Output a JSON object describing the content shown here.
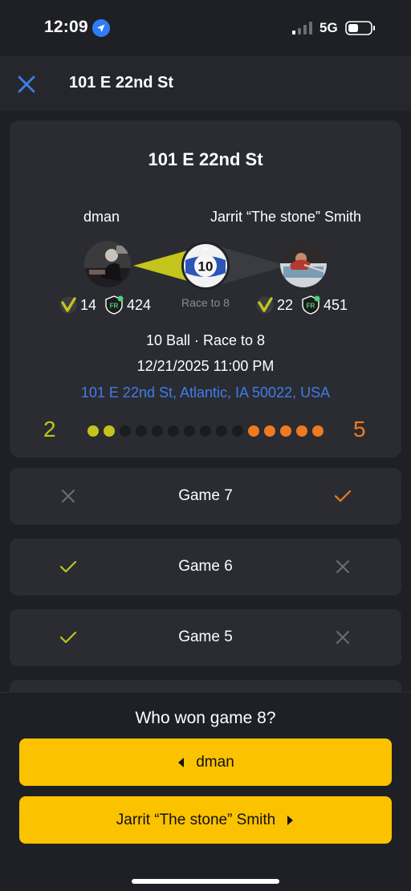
{
  "status_bar": {
    "time": "12:09",
    "network": "5G"
  },
  "header": {
    "title": "101 E 22nd St"
  },
  "match": {
    "title": "101 E 22nd St",
    "player1": {
      "name": "dman",
      "verified_count": "14",
      "rating": "424",
      "score": "2"
    },
    "player2": {
      "name": "Jarrit “The stone” Smith",
      "verified_count": "22",
      "rating": "451",
      "score": "5"
    },
    "ball_number": "10",
    "race_label": "Race to 8",
    "format": "10 Ball · Race to 8",
    "datetime": "12/21/2025 11:00 PM",
    "address": "101 E 22nd St, Atlantic, IA 50022, USA",
    "race_to": 8,
    "total_dots": 15,
    "colors": {
      "player1": "#c4c41c",
      "player2": "#ef7a1f",
      "link": "#3f7de8",
      "button": "#fbc200"
    }
  },
  "games": [
    {
      "label": "Game 7",
      "player1_result": "loss",
      "player2_result": "win"
    },
    {
      "label": "Game 6",
      "player1_result": "win",
      "player2_result": "loss"
    },
    {
      "label": "Game 5",
      "player1_result": "win",
      "player2_result": "loss"
    }
  ],
  "prompt": {
    "question": "Who won game  8?",
    "player1_button": "dman",
    "player2_button": "Jarrit “The stone” Smith"
  },
  "icons": [
    "location-arrow-icon",
    "signal-icon",
    "battery-icon",
    "close-icon",
    "verified-check-icon",
    "fr-badge-icon",
    "ten-ball-icon",
    "check-icon",
    "x-icon",
    "caret-left-icon",
    "caret-right-icon"
  ]
}
